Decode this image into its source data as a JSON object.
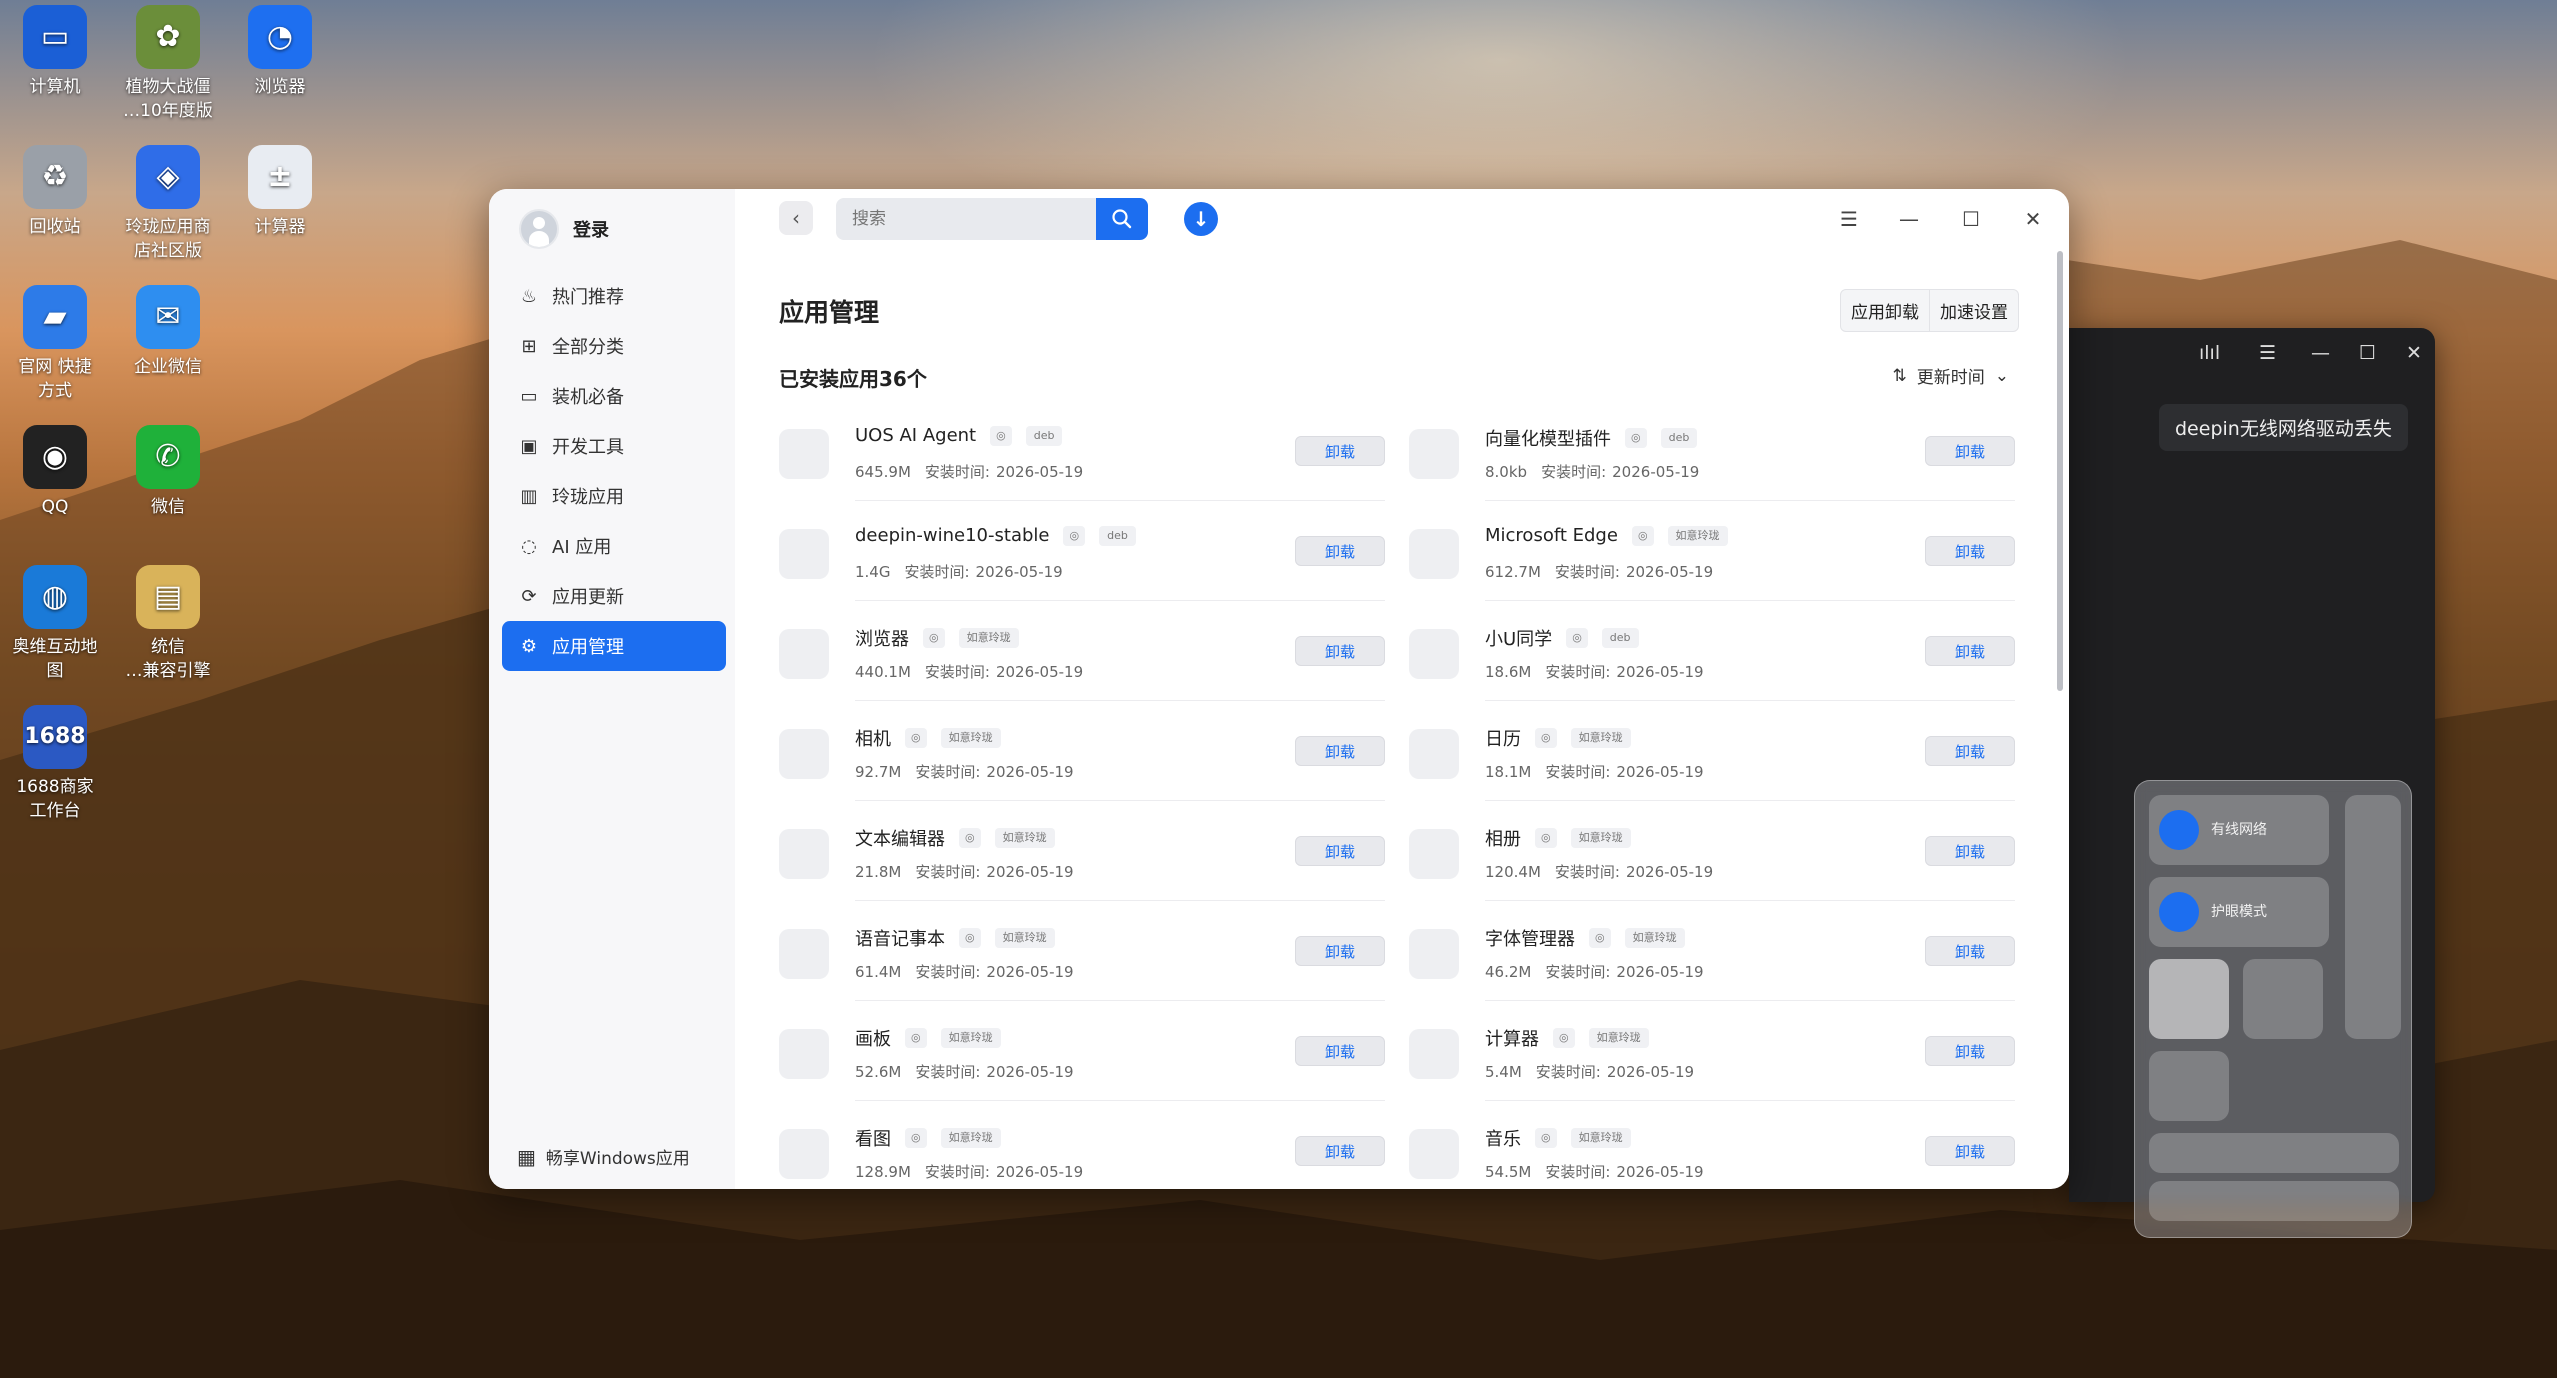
{
  "desktop": {
    "icons": [
      {
        "label": "计算机",
        "glyph": "▭",
        "color": "#1b5fd6"
      },
      {
        "label": "植物大战僵\n…10年度版",
        "glyph": "✿",
        "color": "#6b8e3a"
      },
      {
        "label": "浏览器",
        "glyph": "◔",
        "color": "#1e6ff0"
      },
      {
        "label": "回收站",
        "glyph": "♻",
        "color": "#9aa0a8"
      },
      {
        "label": "玲珑应用商\n店社区版",
        "glyph": "◈",
        "color": "#2f6de8"
      },
      {
        "label": "计算器",
        "glyph": "±",
        "color": "#e8ecf2"
      },
      {
        "label": "官网 快捷\n方式",
        "glyph": "▰",
        "color": "#2d7be8"
      },
      {
        "label": "企业微信",
        "glyph": "✉",
        "color": "#2e8ef0"
      },
      {
        "label": "QQ",
        "glyph": "◉",
        "color": "#222"
      },
      {
        "label": "微信",
        "glyph": "✆",
        "color": "#1fb13a"
      },
      {
        "label": "奥维互动地\n图",
        "glyph": "◍",
        "color": "#1a7ad8"
      },
      {
        "label": "统信\n…兼容引擎",
        "glyph": "▤",
        "color": "#d9b35a"
      },
      {
        "label": "1688商家\n工作台",
        "glyph": "1688",
        "color": "#2b59c3"
      }
    ]
  },
  "sidebar": {
    "login": "登录",
    "items": [
      {
        "label": "热门推荐",
        "icon": "flame-icon",
        "glyph": "♨"
      },
      {
        "label": "全部分类",
        "icon": "grid-icon",
        "glyph": "⊞"
      },
      {
        "label": "装机必备",
        "icon": "monitor-icon",
        "glyph": "▭"
      },
      {
        "label": "开发工具",
        "icon": "terminal-icon",
        "glyph": "▣"
      },
      {
        "label": "玲珑应用",
        "icon": "building-icon",
        "glyph": "▥"
      },
      {
        "label": "AI 应用",
        "icon": "ai-icon",
        "glyph": "◌"
      },
      {
        "label": "应用更新",
        "icon": "refresh-icon",
        "glyph": "⟳"
      },
      {
        "label": "应用管理",
        "icon": "manage-icon",
        "glyph": "⚙"
      }
    ],
    "active_index": 7,
    "windows_apps": "畅享Windows应用"
  },
  "toolbar": {
    "search_placeholder": "搜索"
  },
  "content": {
    "title": "应用管理",
    "seg_uninstall": "应用卸载",
    "seg_speed": "加速设置",
    "installed_count": "已安装应用36个",
    "sort_label": "更新时间",
    "uninstall_label": "卸载",
    "install_time_label": "安装时间:",
    "apps": [
      {
        "name": "UOS AI Agent",
        "tag": "deb",
        "size": "645.9M",
        "date": "2026-05-19"
      },
      {
        "name": "向量化模型插件",
        "tag": "deb",
        "size": "8.0kb",
        "date": "2026-05-19"
      },
      {
        "name": "deepin-wine10-stable",
        "tag": "deb",
        "size": "1.4G",
        "date": "2026-05-19"
      },
      {
        "name": "Microsoft Edge",
        "tag": "如意玲珑",
        "size": "612.7M",
        "date": "2026-05-19"
      },
      {
        "name": "浏览器",
        "tag": "如意玲珑",
        "size": "440.1M",
        "date": "2026-05-19"
      },
      {
        "name": "小U同学",
        "tag": "deb",
        "size": "18.6M",
        "date": "2026-05-19"
      },
      {
        "name": "相机",
        "tag": "如意玲珑",
        "size": "92.7M",
        "date": "2026-05-19"
      },
      {
        "name": "日历",
        "tag": "如意玲珑",
        "size": "18.1M",
        "date": "2026-05-19"
      },
      {
        "name": "文本编辑器",
        "tag": "如意玲珑",
        "size": "21.8M",
        "date": "2026-05-19"
      },
      {
        "name": "相册",
        "tag": "如意玲珑",
        "size": "120.4M",
        "date": "2026-05-19"
      },
      {
        "name": "语音记事本",
        "tag": "如意玲珑",
        "size": "61.4M",
        "date": "2026-05-19"
      },
      {
        "name": "字体管理器",
        "tag": "如意玲珑",
        "size": "46.2M",
        "date": "2026-05-19"
      },
      {
        "name": "画板",
        "tag": "如意玲珑",
        "size": "52.6M",
        "date": "2026-05-19"
      },
      {
        "name": "计算器",
        "tag": "如意玲珑",
        "size": "5.4M",
        "date": "2026-05-19"
      },
      {
        "name": "看图",
        "tag": "如意玲珑",
        "size": "128.9M",
        "date": "2026-05-19"
      },
      {
        "name": "音乐",
        "tag": "如意玲珑",
        "size": "54.5M",
        "date": "2026-05-19"
      }
    ]
  },
  "dark_window": {
    "chip": "deepin无线网络驱动丢失"
  },
  "control_center": {
    "wired": "有线网络",
    "eye": "护眼模式"
  },
  "colors": {
    "accent": "#1c6ef0"
  }
}
